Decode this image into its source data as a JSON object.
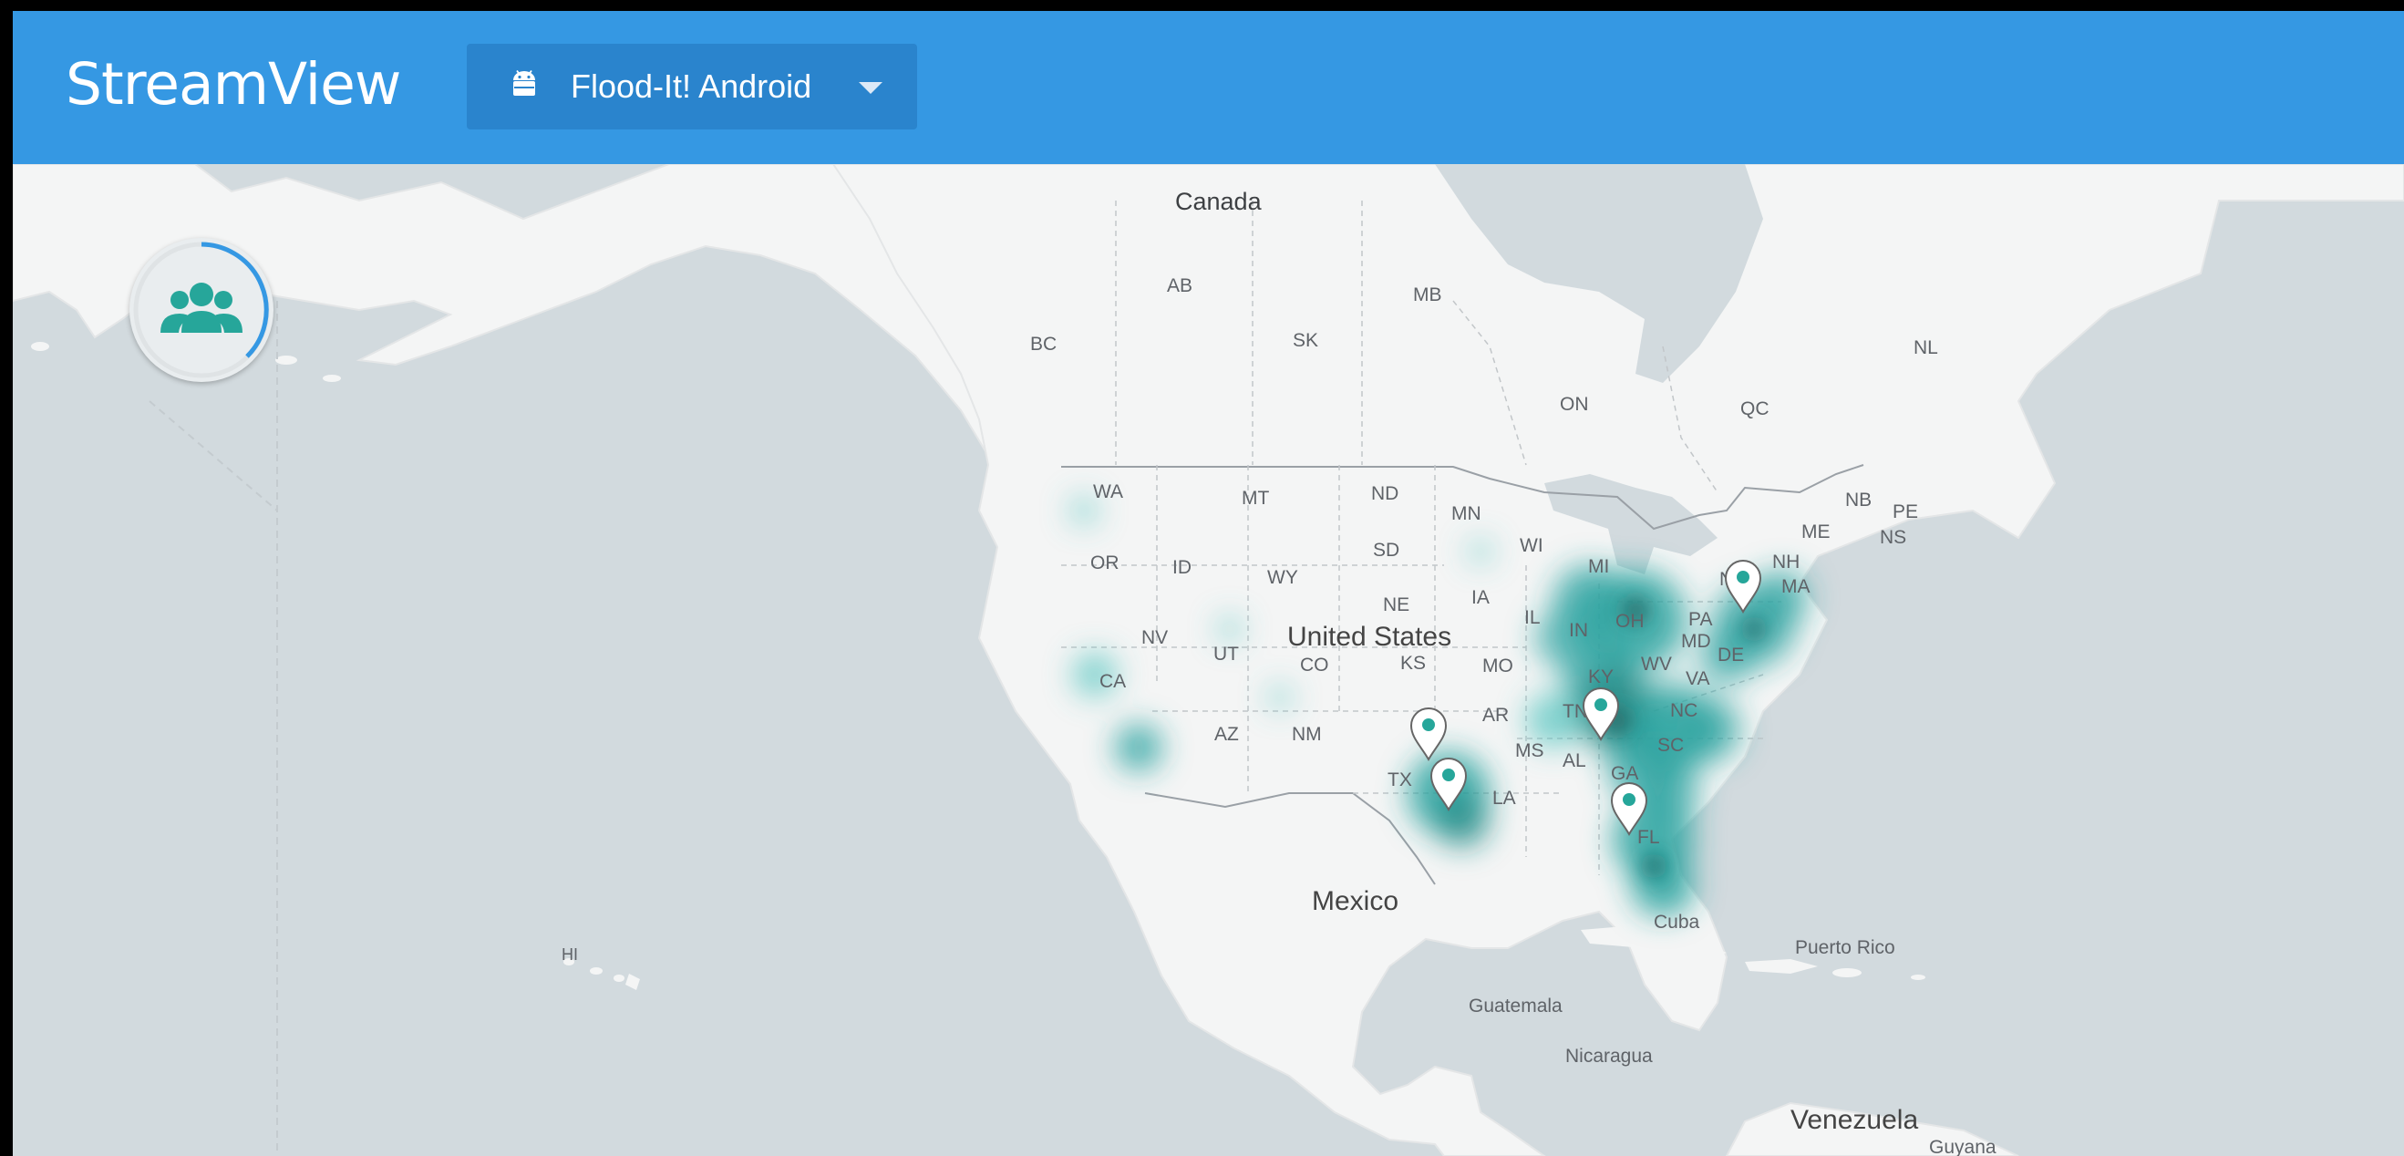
{
  "app": {
    "brand": "StreamView",
    "selected_app": "Flood-It! Android",
    "accent_color": "#3598e3",
    "heat_color": "#4fc3bd"
  },
  "controls": {
    "users_icon": "users-group-icon",
    "dropdown_icon": "caret-down-icon",
    "platform_icon": "android-icon"
  },
  "map": {
    "countries": {
      "canada": "Canada",
      "usa": "United States",
      "mexico": "Mexico",
      "cuba": "Cuba",
      "puerto_rico": "Puerto Rico",
      "guatemala": "Guatemala",
      "nicaragua": "Nicaragua",
      "venezuela": "Venezuela",
      "guyana": "Guyana"
    },
    "provinces": {
      "BC": "BC",
      "AB": "AB",
      "SK": "SK",
      "MB": "MB",
      "ON": "ON",
      "QC": "QC",
      "NL": "NL",
      "NB": "NB",
      "PE": "PE",
      "NS": "NS"
    },
    "states": {
      "WA": "WA",
      "OR": "OR",
      "CA": "CA",
      "ID": "ID",
      "NV": "NV",
      "MT": "MT",
      "WY": "WY",
      "UT": "UT",
      "AZ": "AZ",
      "CO": "CO",
      "NM": "NM",
      "ND": "ND",
      "SD": "SD",
      "NE": "NE",
      "KS": "KS",
      "TX": "TX",
      "MN": "MN",
      "IA": "IA",
      "MO": "MO",
      "AR": "AR",
      "LA": "LA",
      "WI": "WI",
      "IL": "IL",
      "MI": "MI",
      "IN": "IN",
      "OH": "OH",
      "KY": "KY",
      "TN": "TN",
      "MS": "MS",
      "AL": "AL",
      "GA": "GA",
      "FL": "FL",
      "SC": "SC",
      "NC": "NC",
      "VA": "VA",
      "WV": "WV",
      "PA": "PA",
      "NY": "NY",
      "MD": "MD",
      "DE": "DE",
      "NH": "NH",
      "MA": "MA",
      "ME": "ME",
      "HI": "HI"
    },
    "pins": [
      "texas-north",
      "texas-south",
      "tennessee",
      "florida",
      "new-york"
    ]
  }
}
